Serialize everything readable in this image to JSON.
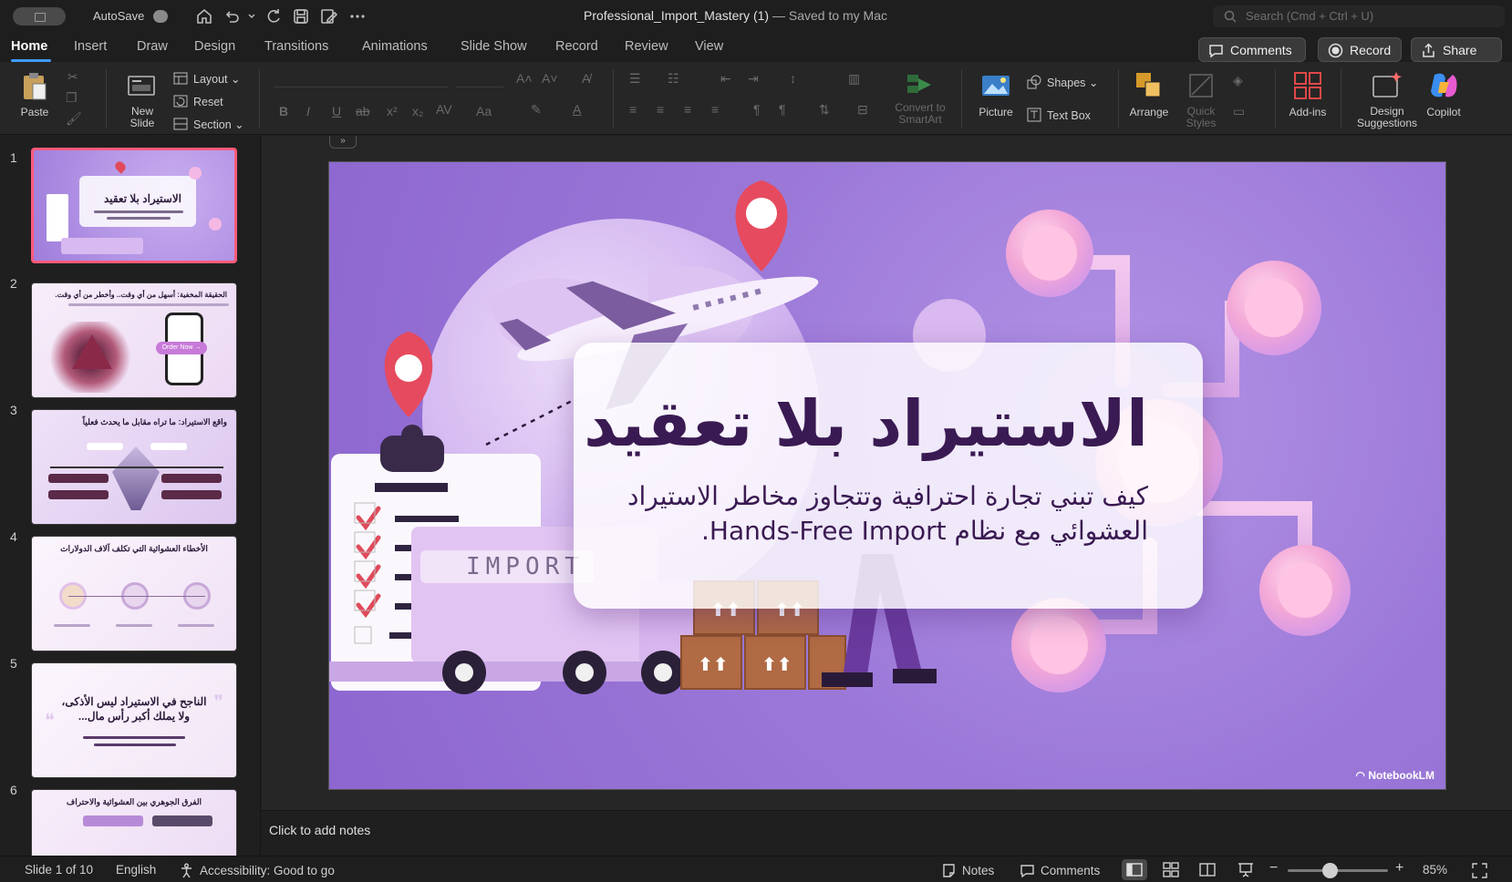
{
  "titlebar": {
    "autosave_label": "AutoSave",
    "document_name": "Professional_Import_Mastery (1)",
    "save_status": "— Saved to my Mac",
    "search_placeholder": "Search (Cmd + Ctrl + U)"
  },
  "tabs": [
    "Home",
    "Insert",
    "Draw",
    "Design",
    "Transitions",
    "Animations",
    "Slide Show",
    "Record",
    "Review",
    "View"
  ],
  "active_tab": "Home",
  "header_buttons": {
    "comments": "Comments",
    "record": "Record",
    "share": "Share"
  },
  "ribbon": {
    "paste": "Paste",
    "new_slide_line1": "New",
    "new_slide_line2": "Slide",
    "layout": "Layout",
    "reset": "Reset",
    "section": "Section",
    "convert_line1": "Convert to",
    "convert_line2": "SmartArt",
    "picture": "Picture",
    "shapes": "Shapes",
    "text_box": "Text Box",
    "arrange": "Arrange",
    "quick_styles_line1": "Quick",
    "quick_styles_line2": "Styles",
    "add_ins": "Add-ins",
    "design_suggestions_line1": "Design",
    "design_suggestions_line2": "Suggestions",
    "copilot": "Copilot"
  },
  "thumbnails": [
    {
      "num": "1",
      "title": "الاستيراد بلا تعقيد",
      "selected": true
    },
    {
      "num": "2",
      "title": "الحقيقة المخفية: أسهل من أي وقت.. وأخطر من أي وقت."
    },
    {
      "num": "3",
      "title": "واقع الاستيراد: ما تراه مقابل ما يحدث فعلياً"
    },
    {
      "num": "4",
      "title": "الأخطاء العشوائية التي تكلف آلاف الدولارات"
    },
    {
      "num": "5",
      "title": "الناجح في الاستيراد ليس الأذكى، ولا يملك أكبر رأس مال..."
    },
    {
      "num": "6",
      "title": "الفرق الجوهري بين العشوائية والاحتراف"
    }
  ],
  "thumb2_button": "Order Now →",
  "slide": {
    "title": "الاستيراد بلا تعقيد",
    "subtitle_line1": "كيف تبني تجارة احترافية وتتجاوز مخاطر الاستيراد",
    "subtitle_line2": "العشوائي مع نظام Hands-Free Import.",
    "import_label": "IMPORT",
    "watermark": "NotebookLM"
  },
  "notes_placeholder": "Click to add notes",
  "status": {
    "slide_position": "Slide 1 of 10",
    "language": "English",
    "accessibility": "Accessibility: Good to go",
    "notes": "Notes",
    "comments": "Comments",
    "zoom": "85%"
  },
  "zoom_level": 0.85,
  "colors": {
    "accent_tab": "#3e9cff",
    "selected_thumb_border": "#ff5a7a",
    "slide_bg": "#9b78d8",
    "title_text": "#3a1a52"
  }
}
